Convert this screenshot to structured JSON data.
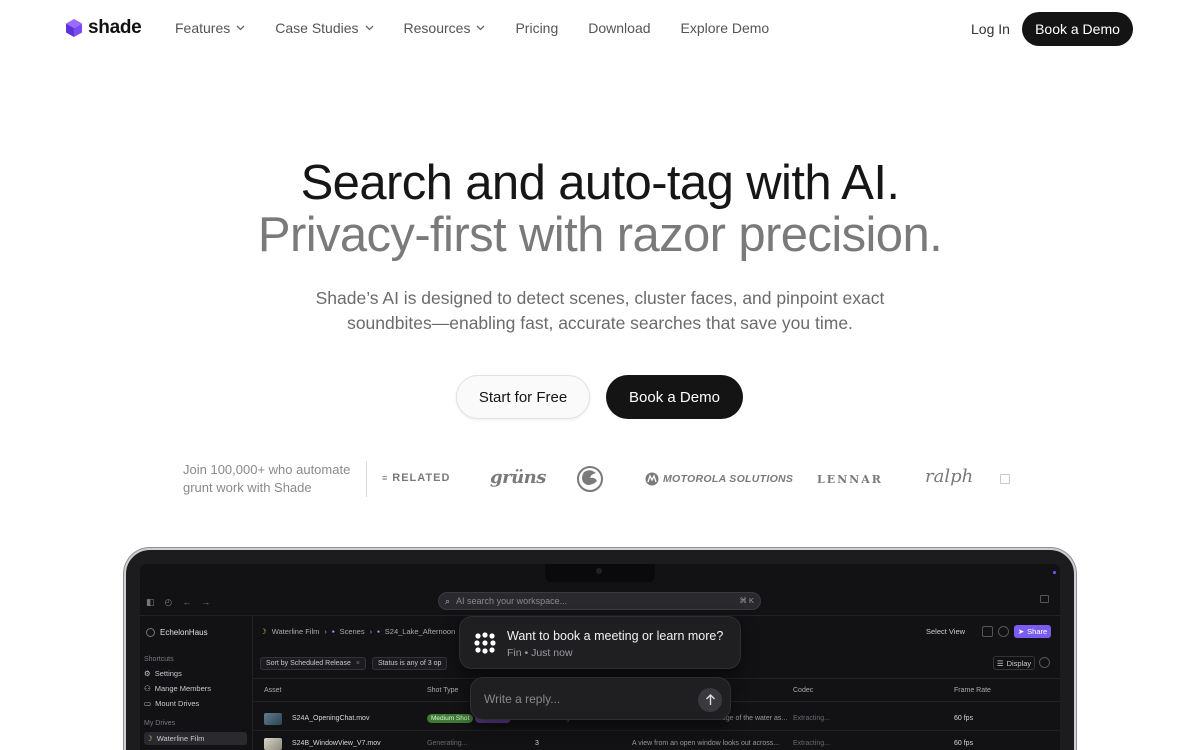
{
  "nav": {
    "brand": "shade",
    "links": [
      {
        "label": "Features",
        "dropdown": true
      },
      {
        "label": "Case Studies",
        "dropdown": true
      },
      {
        "label": "Resources",
        "dropdown": true
      },
      {
        "label": "Pricing",
        "dropdown": false
      },
      {
        "label": "Download",
        "dropdown": false
      },
      {
        "label": "Explore Demo",
        "dropdown": false
      }
    ],
    "login": "Log In",
    "cta": "Book a Demo"
  },
  "hero": {
    "title_line1": "Search and auto-tag with AI.",
    "title_line2": "Privacy-first with razor precision.",
    "subtitle": "Shade’s AI is designed to detect scenes, cluster faces, and pinpoint exact soundbites—enabling fast, accurate searches that save you time.",
    "primary_cta": "Start for Free",
    "secondary_cta": "Book a Demo"
  },
  "social_proof": {
    "text": "Join 100,000+ who automate grunt work with Shade",
    "brands": [
      "RELATED",
      "grüns",
      "MOTOROLA SOLUTIONS",
      "LENNAR",
      "ralph"
    ]
  },
  "app": {
    "search_placeholder": "AI search your workspace...",
    "search_shortcut": "⌘ K",
    "workspace": "EchelonHaus",
    "shortcuts_label": "Shortcuts",
    "shortcuts": [
      "Settings",
      "Mange Members",
      "Mount Drives"
    ],
    "drives_label": "My Drives",
    "drives": [
      "Waterline Film"
    ],
    "breadcrumb": [
      "Waterline Film",
      "Scenes",
      "S24_Lake_Afternoon"
    ],
    "select_view": "Select View",
    "share": "Share",
    "filters": [
      "Sort by Scheduled Release",
      "Status is any of  3 op"
    ],
    "display": "Display",
    "columns": [
      "Asset",
      "Shot Type",
      "Codec",
      "Frame Rate"
    ],
    "rows": [
      {
        "asset": "S24A_OpeningChat.mov",
        "shot_type": "Medium Shot",
        "shot_tag2": "Individual",
        "col3": "Generating...",
        "description": "Matt and Kiran stand at the edge of the water as...",
        "codec": "Extracting...",
        "frame_rate": "60 fps"
      },
      {
        "asset": "S24B_WindowView_V7.mov",
        "shot_type": "Generating...",
        "shot_tag2": "",
        "col3": "3",
        "description": "A view from an open window looks out across...",
        "codec": "Extracting...",
        "frame_rate": "60 fps"
      }
    ]
  },
  "chat": {
    "title": "Want to book a meeting or learn more?",
    "meta": "Fin • Just now",
    "reply_placeholder": "Write a reply..."
  },
  "colors": {
    "brand_purple": "#7b5cf0",
    "dark": "#141414",
    "muted": "#7a7a7a"
  }
}
